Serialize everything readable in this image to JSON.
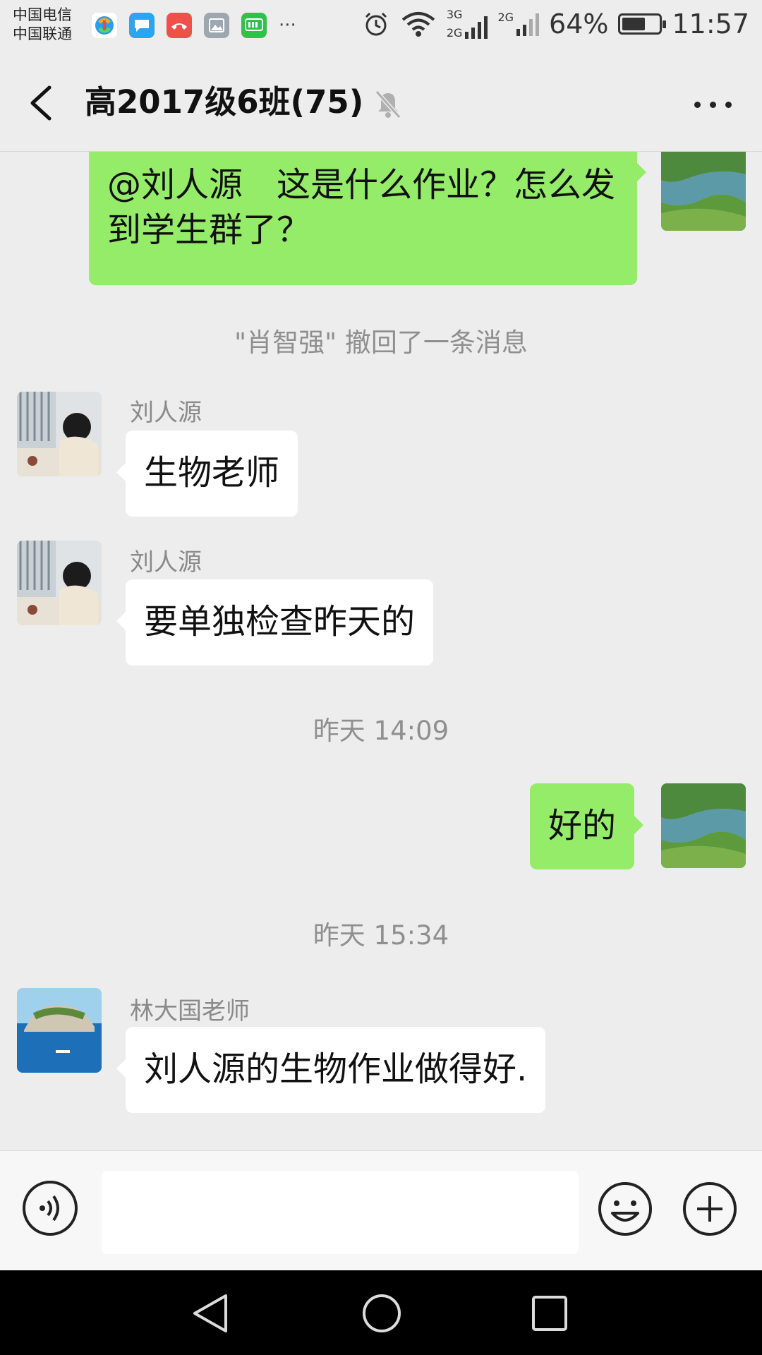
{
  "statusbar": {
    "carrier1": "中国电信",
    "carrier2": "中国联通",
    "notif_more": "···",
    "net1_top": "3G",
    "net1_bottom": "2G",
    "net2": "2G",
    "battery_text": "64%",
    "battery_level": 0.64,
    "time": "11:57"
  },
  "header": {
    "title": "高2017级6班(75)"
  },
  "messages": {
    "m1_text": "@刘人源　这是什么作业？怎么发到学生群了？",
    "recall_notice": "\"肖智强\" 撤回了一条消息",
    "m2_sender": "刘人源",
    "m2_text": "生物老师",
    "m3_sender": "刘人源",
    "m3_text": "要单独检查昨天的",
    "time1": "昨天 14:09",
    "m4_text": "好的",
    "time2": "昨天 15:34",
    "m5_sender": "林大国老师",
    "m5_text": "刘人源的生物作业做得好."
  },
  "input": {
    "value": ""
  }
}
